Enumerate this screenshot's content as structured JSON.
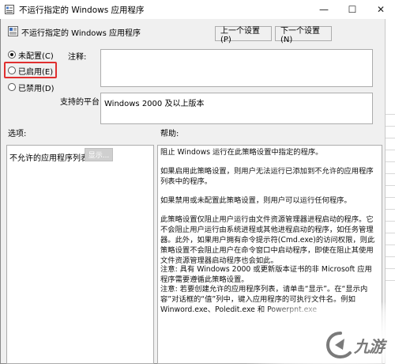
{
  "window": {
    "title": "不运行指定的 Windows 应用程序",
    "controls": {
      "minimize": "—",
      "maximize": "☐",
      "close": "✕"
    }
  },
  "header": {
    "policy_name": "不运行指定的 Windows 应用程序",
    "prev_button": "上一个设置(P)",
    "next_button": "下一个设置(N)"
  },
  "state": {
    "options": [
      {
        "label": "未配置(C)",
        "selected": true
      },
      {
        "label": "已启用(E)",
        "selected": false,
        "highlighted": true
      },
      {
        "label": "已禁用(D)",
        "selected": false
      }
    ]
  },
  "comment": {
    "label": "注释:",
    "value": ""
  },
  "platform": {
    "label": "支持的平台:",
    "value": "Windows 2000 及以上版本"
  },
  "options_section": {
    "label": "选项:",
    "item_label": "不允许的应用程序列表",
    "show_button": "显示..."
  },
  "help_section": {
    "label": "帮助:",
    "paragraphs": [
      "阻止 Windows 运行在此策略设置中指定的程序。",
      "如果启用此策略设置，则用户无法运行已添加到不允许的应用程序列表中的程序。",
      "如果禁用或未配置此策略设置，则用户可以运行任何程序。",
      "此策略设置仅阻止用户运行由文件资源管理器进程启动的程序。它不会阻止用户运行由系统进程或其他进程启动的程序，如任务管理器。此外，如果用户拥有命令提示符(Cmd.exe)的访问权限，则此策略设置不会阻止用户在命令窗口中启动程序，即使在阻止其使用文件资源管理器启动程序也会如此。",
      "注意: 具有 Windows 2000 或更新版本证书的非 Microsoft 应用程序需要遵循此策略设置。",
      "注意: 若要创建允许的应用程序列表，请单击“显示”。在“显示内容”对话框的“值”列中，键入应用程序的可执行文件名。例如 Winword.exe、Poledit.exe 和 Powerpnt.exe"
    ]
  },
  "watermark": {
    "text": "九游"
  },
  "colors": {
    "highlight": "#e03030",
    "window_bg": "#f0f0f0",
    "panel_bg": "#ffffff"
  }
}
